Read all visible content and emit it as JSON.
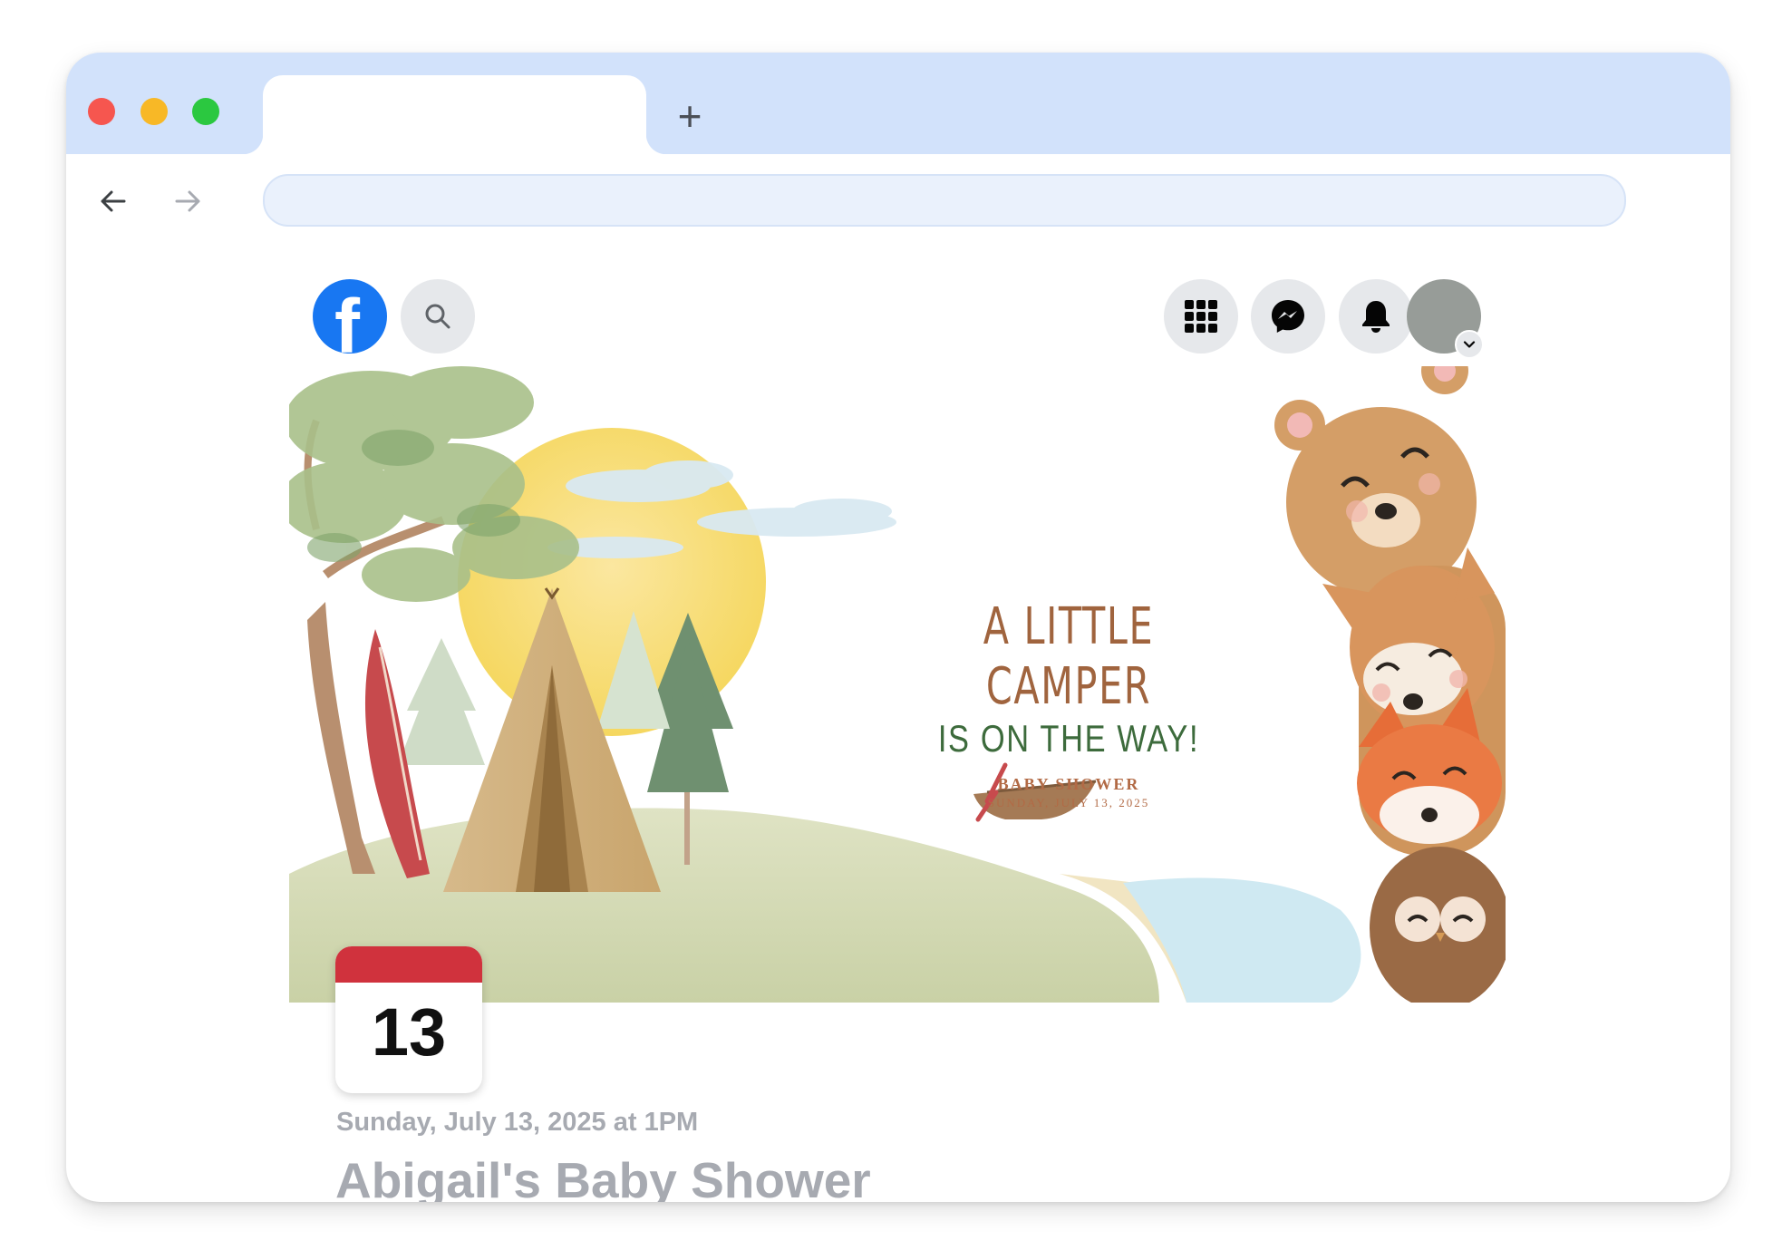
{
  "browser": {
    "traffic_lights": {
      "close": "#f6564f",
      "minimize": "#f8b826",
      "maximize": "#2bc840"
    },
    "tab_title": "",
    "new_tab_label": "+",
    "address": "",
    "chrome_color": "#d2e2fb"
  },
  "facebook": {
    "logo_letter": "f",
    "brand_color": "#1877f2",
    "icons": [
      "search-icon",
      "menu-grid-icon",
      "messenger-icon",
      "bell-icon",
      "account-avatar"
    ]
  },
  "event": {
    "cover": {
      "line1": "A LITTLE CAMPER",
      "line2": "IS ON THE WAY!",
      "line3": "BABY SHOWER",
      "line4": "SUNDAY, JULY 13, 2025"
    },
    "calendar_day": "13",
    "calendar_color": "#d0323d",
    "date_text": "Sunday, July 13, 2025 at 1PM",
    "title": "Abigail's Baby Shower"
  }
}
